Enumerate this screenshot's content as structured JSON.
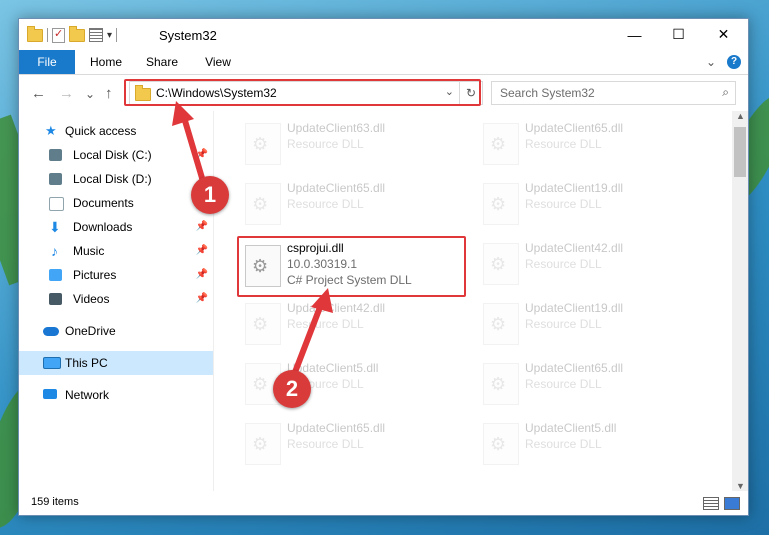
{
  "window": {
    "title": "System32"
  },
  "titlebar": {
    "minimize": "—",
    "maximize": "☐",
    "close": "✕",
    "dropdown": "▾"
  },
  "ribbon": {
    "tabs": [
      "File",
      "Home",
      "Share",
      "View"
    ],
    "collapse": "⌄",
    "help": "?"
  },
  "nav": {
    "back": "←",
    "forward": "→",
    "recent": "⌄",
    "up": "↑",
    "address": "C:\\Windows\\System32",
    "address_dropdown": "⌄",
    "refresh": "↻",
    "search_placeholder": "Search System32",
    "search_icon": "⌕"
  },
  "sidebar": {
    "items": [
      {
        "label": "Quick access",
        "icon": "star-icon",
        "color": "#1e88e5",
        "pin": ""
      },
      {
        "label": "Local Disk (C:)",
        "icon": "drive-icon",
        "color": "#607d8b",
        "pin": "📌"
      },
      {
        "label": "Local Disk (D:)",
        "icon": "drive-icon",
        "color": "#607d8b",
        "pin": ""
      },
      {
        "label": "Documents",
        "icon": "documents-icon",
        "color": "#90a4ae",
        "pin": ""
      },
      {
        "label": "Downloads",
        "icon": "downloads-icon",
        "color": "#1e88e5",
        "pin": "📌"
      },
      {
        "label": "Music",
        "icon": "music-icon",
        "color": "#1e88e5",
        "pin": "📌"
      },
      {
        "label": "Pictures",
        "icon": "pictures-icon",
        "color": "#42a5f5",
        "pin": "📌"
      },
      {
        "label": "Videos",
        "icon": "videos-icon",
        "color": "#455a64",
        "pin": "📌"
      },
      {
        "label": "OneDrive",
        "icon": "onedrive-icon",
        "color": "#1976d2",
        "pin": ""
      },
      {
        "label": "This PC",
        "icon": "pc-icon",
        "color": "#42a5f5",
        "pin": ""
      },
      {
        "label": "Network",
        "icon": "network-icon",
        "color": "#1e88e5",
        "pin": ""
      }
    ]
  },
  "files": {
    "highlighted": {
      "name": "csprojui.dll",
      "version": "10.0.30319.1",
      "type": "C# Project System DLL"
    },
    "faded": [
      {
        "name": "UpdateClient63.dll",
        "type": "Resource DLL"
      },
      {
        "name": "UpdateClient65.dll",
        "type": "Resource DLL"
      },
      {
        "name": "UpdateClient65.dll",
        "type": "Resource DLL"
      },
      {
        "name": "UpdateClient19.dll",
        "type": "Resource DLL"
      },
      {
        "name": "UpdateClient42.dll",
        "type": "Resource DLL"
      },
      {
        "name": "UpdateClient42.dll",
        "type": "Resource DLL"
      },
      {
        "name": "UpdateClient19.dll",
        "type": "Resource DLL"
      },
      {
        "name": "UpdateClient5.dll",
        "type": "Resource DLL"
      },
      {
        "name": "UpdateClient65.dll",
        "type": "Resource DLL"
      },
      {
        "name": "UpdateClient65.dll",
        "type": "Resource DLL"
      },
      {
        "name": "UpdateClient5.dll",
        "type": "Resource DLL"
      }
    ]
  },
  "status": {
    "count": "159 items"
  },
  "annotations": {
    "step1": "1",
    "step2": "2",
    "color": "#e0373b"
  }
}
